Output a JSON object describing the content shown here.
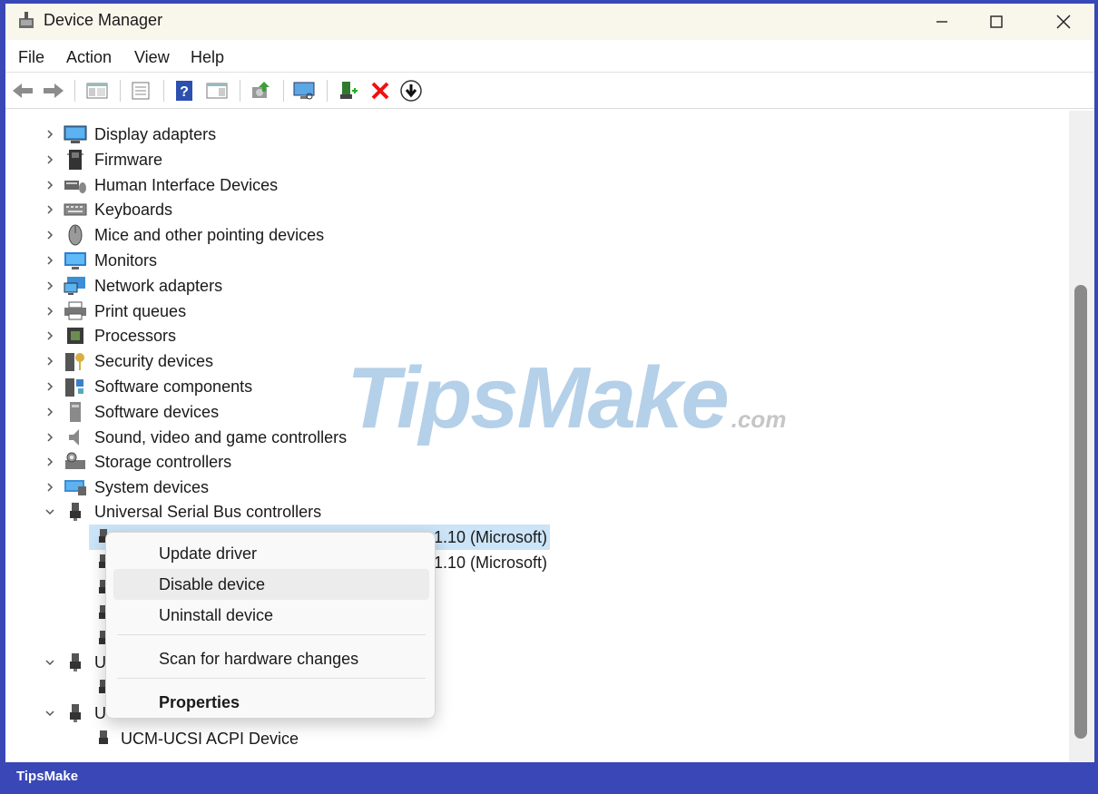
{
  "window": {
    "title": "Device Manager"
  },
  "menu": [
    "File",
    "Action",
    "View",
    "Help"
  ],
  "toolbar_icons": [
    "back-arrow-icon",
    "forward-arrow-icon",
    "show-hide-tree-icon",
    "properties-sheet-icon",
    "help-icon",
    "action-pane-icon",
    "update-driver-icon",
    "scan-hardware-icon",
    "add-legacy-icon",
    "uninstall-icon",
    "disable-icon"
  ],
  "tree": {
    "categories": [
      {
        "label": "Display adapters",
        "icon": "display-adapter-icon"
      },
      {
        "label": "Firmware",
        "icon": "firmware-icon"
      },
      {
        "label": "Human Interface Devices",
        "icon": "hid-icon"
      },
      {
        "label": "Keyboards",
        "icon": "keyboard-icon"
      },
      {
        "label": "Mice and other pointing devices",
        "icon": "mouse-icon"
      },
      {
        "label": "Monitors",
        "icon": "monitor-icon"
      },
      {
        "label": "Network adapters",
        "icon": "network-adapter-icon"
      },
      {
        "label": "Print queues",
        "icon": "printer-icon"
      },
      {
        "label": "Processors",
        "icon": "processor-icon"
      },
      {
        "label": "Security devices",
        "icon": "security-device-icon"
      },
      {
        "label": "Software components",
        "icon": "software-component-icon"
      },
      {
        "label": "Software devices",
        "icon": "software-device-icon"
      },
      {
        "label": "Sound, video and game controllers",
        "icon": "speaker-icon"
      },
      {
        "label": "Storage controllers",
        "icon": "storage-controller-icon"
      },
      {
        "label": "System devices",
        "icon": "system-device-icon"
      }
    ],
    "usb": {
      "label": "Universal Serial Bus controllers",
      "child1_suffix": "1.10 (Microsoft)",
      "child2_suffix": "1.10 (Microsoft)"
    },
    "partial1": "U",
    "partial2": "U",
    "ucm": "UCM-UCSI ACPI Device"
  },
  "context_menu": {
    "update": "Update driver",
    "disable": "Disable device",
    "uninstall": "Uninstall device",
    "scan": "Scan for hardware changes",
    "properties": "Properties"
  },
  "watermark": {
    "main": "TipsMake",
    "domain": ".com"
  },
  "footer": "TipsMake",
  "colors": {
    "frame": "#3a47b6",
    "selection": "#cce4f7",
    "titlebar": "#f9f6ec"
  }
}
